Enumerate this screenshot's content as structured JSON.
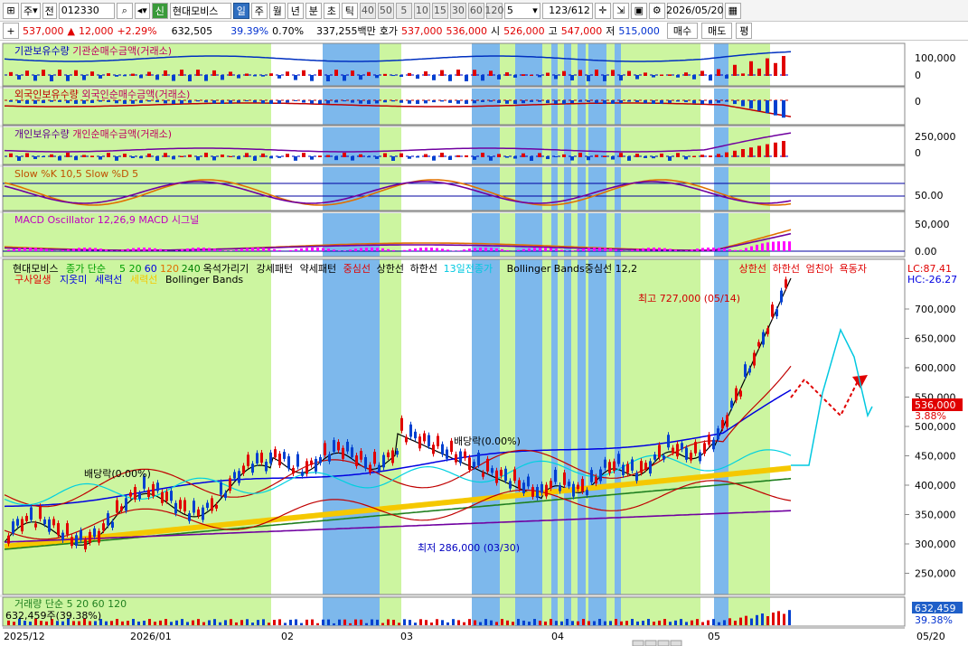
{
  "toolbar": {
    "period_type": "주",
    "prev_label": "전",
    "stock_code": "012330",
    "stock_badge": "신",
    "stock_name": "현대모비스",
    "periods": [
      "일",
      "주",
      "월",
      "년",
      "분",
      "초",
      "틱"
    ],
    "active_period": "일",
    "intervals": [
      "40",
      "50",
      "5",
      "10",
      "15",
      "30",
      "60",
      "120"
    ],
    "interval_value": "5",
    "page_counter": "123/612",
    "date": "2026/05/20"
  },
  "quote": {
    "price": "537,000",
    "change_arrow": "▲",
    "change": "12,000",
    "change_pct": "+2.29%",
    "volume": "632,505",
    "volume_ratio": "39.39%",
    "turnover_pct": "0.70%",
    "amount": "337,255백만",
    "ask_label": "호가",
    "ask": "537,000",
    "bid": "536,000",
    "open_label": "시",
    "open": "526,000",
    "high_label": "고",
    "high": "547,000",
    "low_label": "저",
    "low": "515,000",
    "buy_button": "매수",
    "sell_button": "매도",
    "eval_button": "평"
  },
  "panels": {
    "inst_title": [
      "기관보유수량",
      "기관순매수금액(거래소)"
    ],
    "inst_axis": [
      "100,000",
      "0"
    ],
    "foreign_title": [
      "외국인보유수량",
      "외국인순매수금액(거래소)"
    ],
    "foreign_axis": [
      "0"
    ],
    "indiv_title": [
      "개인보유수량",
      "개인순매수금액(거래소)"
    ],
    "indiv_axis": [
      "250,000",
      "0"
    ],
    "stoch_title": "Slow %K 10,5  Slow %D 5",
    "stoch_axis": [
      "50.00"
    ],
    "macd_title": "MACD Oscillator 12,26,9  MACD  시그널",
    "macd_axis": [
      "50,000",
      "0.00"
    ],
    "volume_title": "거래량  단순  5  20  60  120",
    "volume_value": "632,459주(39.38%)",
    "volume_axis_value": "632,459",
    "volume_axis_pct": "39.38%"
  },
  "main_legend": {
    "line1": [
      "현대모비스",
      "종가 단순",
      "5",
      "20",
      "60",
      "120",
      "240",
      "옥석가리기",
      "강세패턴",
      "약세패턴",
      "중심선",
      "상한선",
      "하한선",
      "13일전종가",
      "Bollinger Bands중심선 12,2",
      "상한선",
      "하한선",
      "엄친아",
      "욕동자"
    ],
    "line2": [
      "구사일생",
      "지옷미",
      "세력선",
      "세력선",
      "Bollinger Bands"
    ],
    "lc": "LC:87.41",
    "hc": "HC:-26.27"
  },
  "price_axis": [
    "700,000",
    "650,000",
    "600,000",
    "550,000",
    "500,000",
    "450,000",
    "400,000",
    "350,000",
    "300,000",
    "250,000"
  ],
  "current_price_tag": "536,000",
  "current_pct_tag": "3.88%",
  "annotations": {
    "high": "최고 727,000 (05/14)",
    "low": "최저 286,000 (03/30)",
    "dividend1": "배당락(0.00%)",
    "dividend2": "배당락(0.00%)"
  },
  "x_axis": [
    "2025/12",
    "2026/01",
    "02",
    "03",
    "04",
    "05",
    "05/20"
  ],
  "colors": {
    "green_band": "#ccf5a0",
    "blue_band": "#7db8ec",
    "up": "#e00000",
    "down": "#0040d0",
    "thick_ma": "#f5c800"
  }
}
